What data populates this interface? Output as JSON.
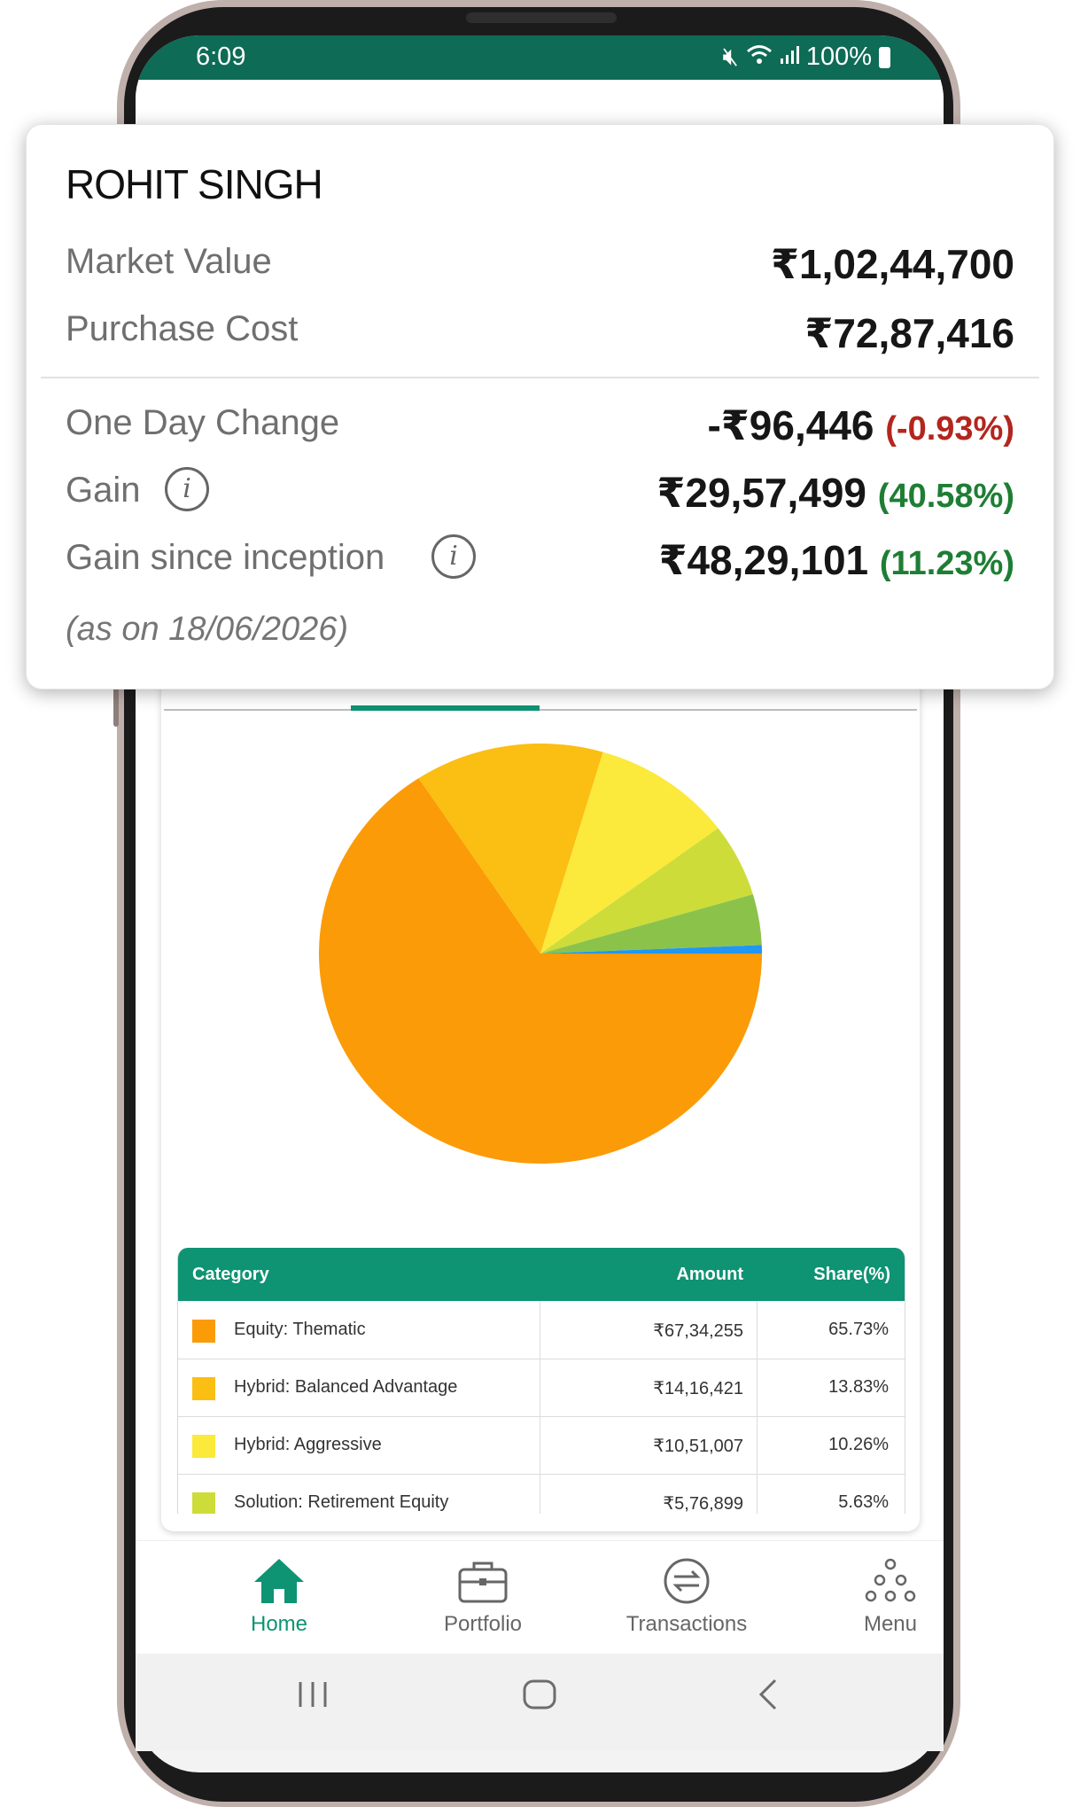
{
  "status_bar": {
    "time": "6:09",
    "battery": "100%"
  },
  "summary": {
    "name": "ROHIT SINGH",
    "market_value_label": "Market Value",
    "market_value": "₹1,02,44,700",
    "purchase_cost_label": "Purchase Cost",
    "purchase_cost": "₹72,87,416",
    "one_day_change_label": "One Day Change",
    "one_day_change": "-₹96,446",
    "one_day_change_pct": "(-0.93%)",
    "gain_label": "Gain",
    "gain": "₹29,57,499",
    "gain_pct": "(40.58%)",
    "gain_inception_label": "Gain since inception",
    "gain_inception": "₹48,29,101",
    "gain_inception_pct": "(11.23%)",
    "as_on": "(as on 18/06/2026)"
  },
  "chart_data": {
    "type": "pie",
    "categories": [
      "Equity: Thematic",
      "Hybrid: Balanced Advantage",
      "Hybrid: Aggressive",
      "Solution: Retirement Equity",
      "Other (green)",
      "Other (blue)"
    ],
    "values": [
      65.73,
      13.83,
      10.26,
      5.63,
      3.9,
      0.65
    ],
    "colors": [
      "#fb9b07",
      "#fbbe12",
      "#fbe93c",
      "#cddc39",
      "#8bc34a",
      "#2196f3"
    ]
  },
  "table": {
    "headers": {
      "category": "Category",
      "amount": "Amount",
      "share": "Share(%)"
    },
    "rows": [
      {
        "category": "Equity: Thematic",
        "amount": "₹67,34,255",
        "share": "65.73%",
        "color": "#fb9b07"
      },
      {
        "category": "Hybrid: Balanced Advantage",
        "amount": "₹14,16,421",
        "share": "13.83%",
        "color": "#fbbe12"
      },
      {
        "category": "Hybrid: Aggressive",
        "amount": "₹10,51,007",
        "share": "10.26%",
        "color": "#fbe93c"
      },
      {
        "category": "Solution: Retirement Equity",
        "amount": "₹5,76,899",
        "share": "5.63%",
        "color": "#cddc39"
      }
    ]
  },
  "bottom_nav": {
    "home": "Home",
    "portfolio": "Portfolio",
    "transactions": "Transactions",
    "menu": "Menu"
  },
  "colors": {
    "brand": "#0e9373",
    "status_bar": "#0e6b55",
    "loss": "#b3261e",
    "profit": "#1e7e34"
  }
}
